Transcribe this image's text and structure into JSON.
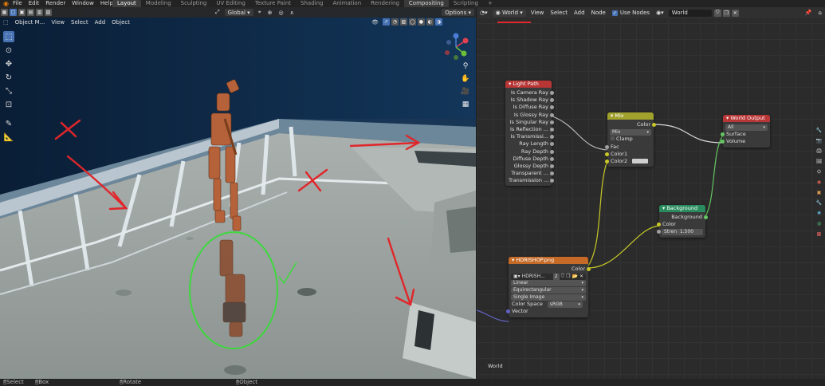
{
  "topbar": {
    "menus": [
      "File",
      "Edit",
      "Render",
      "Window",
      "Help"
    ],
    "workspaces": [
      {
        "label": "Layout",
        "active": true
      },
      {
        "label": "Modeling"
      },
      {
        "label": "Sculpting"
      },
      {
        "label": "UV Editing"
      },
      {
        "label": "Texture Paint"
      },
      {
        "label": "Shading"
      },
      {
        "label": "Animation"
      },
      {
        "label": "Rendering"
      },
      {
        "label": "Compositing"
      },
      {
        "label": "Scripting"
      }
    ],
    "add_tab": "+"
  },
  "viewport": {
    "mode": "Object M...",
    "menus": [
      "View",
      "Select",
      "Add",
      "Object"
    ],
    "orientation": "Global",
    "options_label": "Options"
  },
  "node_editor": {
    "type_selector": "World",
    "menus": [
      "View",
      "Select",
      "Add",
      "Node"
    ],
    "use_nodes_label": "Use Nodes",
    "world_name": "World",
    "corner_label": "World",
    "nodes": {
      "light_path": {
        "title": "Light Path",
        "outputs": [
          "Is Camera Ray",
          "Is Shadow Ray",
          "Is Diffuse Ray",
          "Is Glossy Ray",
          "Is Singular Ray",
          "Is Reflection ...",
          "Is Transmissi...",
          "Ray Length",
          "Ray Depth",
          "Diffuse Depth",
          "Glossy Depth",
          "Transparent ...",
          "Transmission ..."
        ]
      },
      "mix": {
        "title": "Mix",
        "output": "Color",
        "blend_type": "Mix",
        "clamp_label": "Clamp",
        "inputs": [
          "Fac",
          "Color1",
          "Color2"
        ]
      },
      "world_output": {
        "title": "World Output",
        "target": "All",
        "inputs": [
          "Surface",
          "Volume"
        ]
      },
      "background": {
        "title": "Background",
        "output": "Background",
        "input_color": "Color",
        "strength_label": "Stren",
        "strength_value": "1.500"
      },
      "hdri": {
        "title": "HDRISHOP.png",
        "output": "Color",
        "image_name": "HDRISH...",
        "users": "2",
        "interpolation": "Linear",
        "projection": "Equirectangular",
        "source": "Single Image",
        "color_space_label": "Color Space",
        "color_space_value": "sRGB",
        "input_vector": "Vector"
      }
    }
  },
  "statusbar": {
    "items": [
      "Select",
      "Box Select",
      "Rotate View",
      "Object Context Me..."
    ]
  },
  "colors": {
    "accent": "#4772b3",
    "light_path_header": "#b83636",
    "mix_header": "#a1a12e",
    "world_output_header": "#b83636",
    "background_header": "#2a8c5e",
    "image_header": "#c66a28",
    "annotation_red": "#e0262a",
    "annotation_green": "#3ed83e"
  }
}
